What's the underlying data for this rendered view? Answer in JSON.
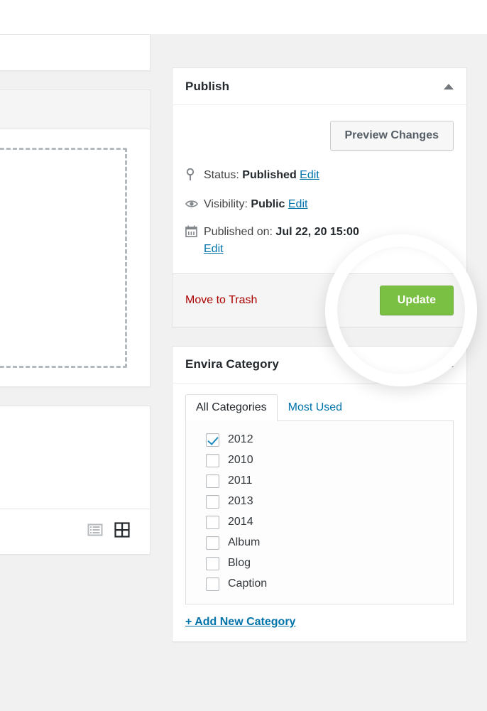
{
  "publish_box": {
    "title": "Publish",
    "toggle_icon": "chevron-up-icon",
    "preview_button": "Preview Changes",
    "status": {
      "icon": "pin-icon",
      "label": "Status:",
      "value": "Published",
      "edit_link": "Edit"
    },
    "visibility": {
      "icon": "eye-icon",
      "label": "Visibility:",
      "value": "Public",
      "edit_link": "Edit"
    },
    "published_on": {
      "icon": "calendar-icon",
      "label": "Published on:",
      "value": "Jul 22, 20",
      "value_tail": "15:00",
      "edit_link": "Edit"
    },
    "trash_link": "Move to Trash",
    "update_button": "Update",
    "update_button_color": "#7ac143"
  },
  "category_box": {
    "title": "Envira Category",
    "toggle_icon": "chevron-up-icon",
    "tabs": [
      {
        "label": "All Categories",
        "active": true
      },
      {
        "label": "Most Used",
        "active": false
      }
    ],
    "categories": [
      {
        "label": "2012",
        "checked": true
      },
      {
        "label": "2010",
        "checked": false
      },
      {
        "label": "2011",
        "checked": false
      },
      {
        "label": "2013",
        "checked": false
      },
      {
        "label": "2014",
        "checked": false
      },
      {
        "label": "Album",
        "checked": false
      },
      {
        "label": "Blog",
        "checked": false
      },
      {
        "label": "Caption",
        "checked": false
      }
    ],
    "add_new_link": "+ Add New Category"
  },
  "left_column": {
    "dropzone_label": "",
    "view_toggles": [
      {
        "icon": "list-view-icon",
        "active": false
      },
      {
        "icon": "grid-view-icon",
        "active": true
      }
    ]
  },
  "overlay": {
    "lens_icon": "magnifier-lens-highlight",
    "lens_color": "#ffffff"
  }
}
